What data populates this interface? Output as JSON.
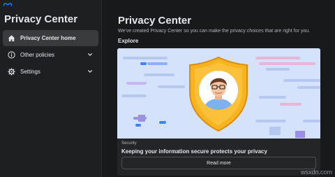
{
  "sidebar": {
    "logo_icon": "meta-logo-icon",
    "title": "Privacy Center",
    "items": [
      {
        "label": "Privacy Center home",
        "icon": "home-icon",
        "active": true
      },
      {
        "label": "Other policies",
        "icon": "info-icon",
        "expandable": true
      },
      {
        "label": "Settings",
        "icon": "gear-icon",
        "expandable": true
      }
    ]
  },
  "main": {
    "title": "Privacy Center",
    "subtitle": "We've created Privacy Center so you can make the privacy choices that are right for you.",
    "section_heading": "Explore",
    "card": {
      "category": "Security",
      "headline": "Keeping your information secure protects your privacy",
      "button_label": "Read more",
      "illustration": "shield-avatar-illustration"
    }
  },
  "watermark": "wsxdn.com",
  "colors": {
    "background": "#18191a",
    "sidebar": "#1e1f21",
    "active_item": "#3a3b3c",
    "illustration_bg": "#d4e2fb",
    "shield_gold": "#f6b51e",
    "text_primary": "#e4e6eb",
    "text_secondary": "#b0b3b8"
  }
}
